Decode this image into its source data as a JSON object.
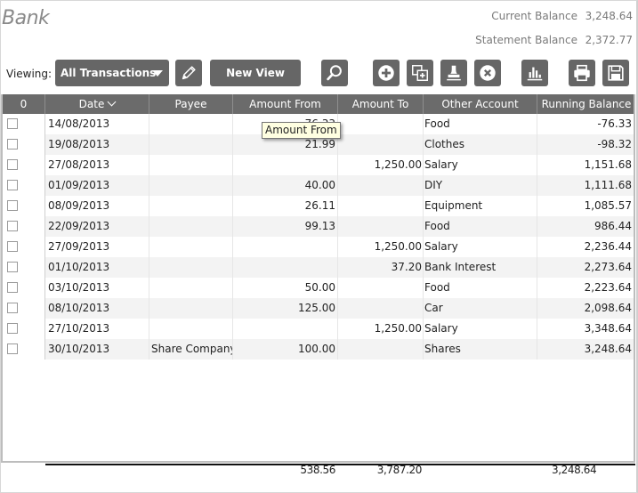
{
  "app": {
    "title": "Bank"
  },
  "balances": {
    "current_label": "Current Balance",
    "current_value": "3,248.64",
    "statement_label": "Statement Balance",
    "statement_value": "2,372.77"
  },
  "toolbar": {
    "viewing_label": "Viewing:",
    "view_selected": "All Transactions",
    "new_view_label": "New View",
    "icons": {
      "edit": "pencil-icon",
      "search": "search-icon",
      "add": "plus-circle-icon",
      "duplicate": "duplicate-icon",
      "reconcile": "stamp-icon",
      "delete": "delete-circle-icon",
      "chart": "bar-chart-icon",
      "print": "printer-icon",
      "save": "save-icon"
    },
    "button_color": "#666666"
  },
  "grid": {
    "columns": [
      {
        "key": "select",
        "label": "0"
      },
      {
        "key": "date",
        "label": "Date",
        "sorted": "desc"
      },
      {
        "key": "payee",
        "label": "Payee"
      },
      {
        "key": "amount_from",
        "label": "Amount From"
      },
      {
        "key": "amount_to",
        "label": "Amount To"
      },
      {
        "key": "other_account",
        "label": "Other Account"
      },
      {
        "key": "running_balance",
        "label": "Running Balance"
      }
    ],
    "rows": [
      {
        "checked": false,
        "date": "14/08/2013",
        "payee": "",
        "amount_from": "76.33",
        "amount_to": "",
        "other_account": "Food",
        "running_balance": "-76.33"
      },
      {
        "checked": false,
        "date": "19/08/2013",
        "payee": "",
        "amount_from": "21.99",
        "amount_to": "",
        "other_account": "Clothes",
        "running_balance": "-98.32"
      },
      {
        "checked": false,
        "date": "27/08/2013",
        "payee": "",
        "amount_from": "",
        "amount_to": "1,250.00",
        "other_account": "Salary",
        "running_balance": "1,151.68"
      },
      {
        "checked": false,
        "date": "01/09/2013",
        "payee": "",
        "amount_from": "40.00",
        "amount_to": "",
        "other_account": "DIY",
        "running_balance": "1,111.68"
      },
      {
        "checked": false,
        "date": "08/09/2013",
        "payee": "",
        "amount_from": "26.11",
        "amount_to": "",
        "other_account": "Equipment",
        "running_balance": "1,085.57"
      },
      {
        "checked": false,
        "date": "22/09/2013",
        "payee": "",
        "amount_from": "99.13",
        "amount_to": "",
        "other_account": "Food",
        "running_balance": "986.44"
      },
      {
        "checked": false,
        "date": "27/09/2013",
        "payee": "",
        "amount_from": "",
        "amount_to": "1,250.00",
        "other_account": "Salary",
        "running_balance": "2,236.44"
      },
      {
        "checked": false,
        "date": "01/10/2013",
        "payee": "",
        "amount_from": "",
        "amount_to": "37.20",
        "other_account": "Bank Interest",
        "running_balance": "2,273.64"
      },
      {
        "checked": false,
        "date": "03/10/2013",
        "payee": "",
        "amount_from": "50.00",
        "amount_to": "",
        "other_account": "Food",
        "running_balance": "2,223.64"
      },
      {
        "checked": false,
        "date": "08/10/2013",
        "payee": "",
        "amount_from": "125.00",
        "amount_to": "",
        "other_account": "Car",
        "running_balance": "2,098.64"
      },
      {
        "checked": false,
        "date": "27/10/2013",
        "payee": "",
        "amount_from": "",
        "amount_to": "1,250.00",
        "other_account": "Salary",
        "running_balance": "3,348.64"
      },
      {
        "checked": false,
        "date": "30/10/2013",
        "payee": "Share Company",
        "amount_from": "100.00",
        "amount_to": "",
        "other_account": "Shares",
        "running_balance": "3,248.64"
      }
    ],
    "header_color": "#6b6b6b",
    "alt_row_color": "#f3f3f3"
  },
  "tooltip": {
    "text": "Amount From"
  },
  "totals": {
    "amount_from": "538.56",
    "amount_to": "3,787.20",
    "running_balance": "3,248.64"
  }
}
